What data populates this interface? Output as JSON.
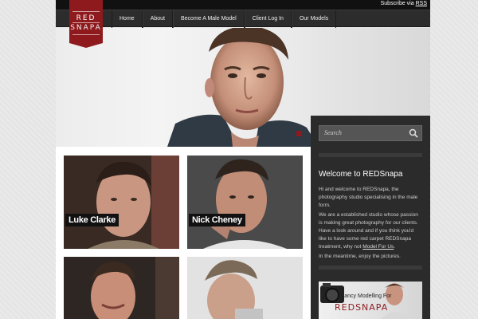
{
  "header": {
    "subscribe_text": "Subscribe via",
    "subscribe_link": "RSS",
    "logo_top": "RED",
    "logo_bottom": "SNAPA"
  },
  "nav": {
    "items": [
      {
        "label": "Home"
      },
      {
        "label": "About"
      },
      {
        "label": "Become A Male Model"
      },
      {
        "label": "Client Log In"
      },
      {
        "label": "Our Models"
      }
    ]
  },
  "sidebar": {
    "search_placeholder": "Search",
    "welcome_title": "Welcome to REDSnapa",
    "paragraph1": "Hi and welcome to REDSnapa, the photography studio specialising in the male form.",
    "paragraph2_before": "We are a established studio whose passion is making great photography for our clients. Have a look around and if you think you'd like to have some red carpet REDSnapa treatment, why not",
    "paragraph2_link": "Model For Us",
    "paragraph2_after": ".",
    "paragraph3": "In the meantime, enjoy the pictures.",
    "ad_line1": "Fancy Modelling For",
    "ad_line2": "REDSNAPA"
  },
  "models": [
    {
      "name": "Luke Clarke"
    },
    {
      "name": "Nick Cheney"
    },
    {
      "name": ""
    },
    {
      "name": ""
    }
  ],
  "colors": {
    "brand_red": "#8e1a1e",
    "nav_bg": "#2c2c2c",
    "sidebar_bg": "#2b2b2b"
  }
}
